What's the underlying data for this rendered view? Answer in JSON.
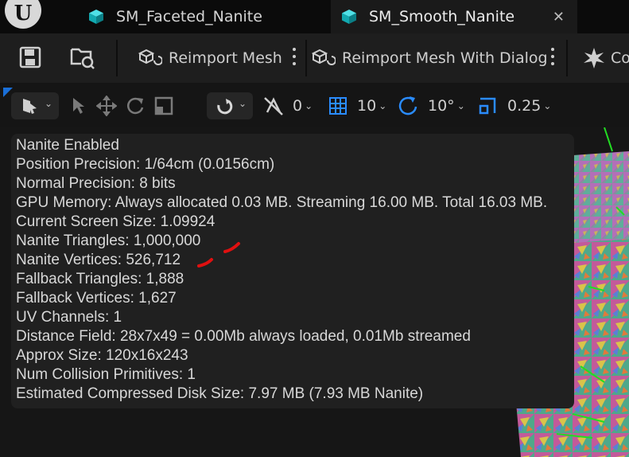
{
  "tabs": [
    {
      "label": "SM_Faceted_Nanite",
      "icon": "static-mesh-icon"
    },
    {
      "label": "SM_Smooth_Nanite",
      "icon": "static-mesh-icon",
      "active": true,
      "close": "✕"
    }
  ],
  "toolbar": {
    "reimport_mesh": "Reimport Mesh",
    "reimport_dialog": "Reimport Mesh With Dialog",
    "collision_partial": "Co"
  },
  "viewport_toolbar": {
    "rotation_snap_value": "0",
    "grid_snap_value": "10",
    "angle_snap_value": "10°",
    "scale_snap_value": "0.25"
  },
  "info_lines": [
    "Nanite Enabled",
    "Position Precision: 1/64cm (0.0156cm)",
    "Normal Precision: 8 bits",
    "GPU Memory: Always allocated 0.03 MB. Streaming 16.00 MB. Total 16.03 MB.",
    "Current Screen Size:  1.09924",
    "Nanite Triangles:  1,000,000",
    "Nanite Vertices:  526,712",
    "Fallback Triangles:  1,888",
    "Fallback Vertices:  1,627",
    "UV Channels:  1",
    "Distance Field:  28x7x49 = 0.00Mb always loaded, 0.01Mb streamed",
    "Approx Size: 120x16x243",
    "Num Collision Primitives:  1",
    "Estimated Compressed Disk Size: 7.97 MB (7.93 MB Nanite)"
  ],
  "colors": {
    "accent_teal": "#16c0c8",
    "accent_blue": "#2a8cff",
    "annotation_red": "#e01010"
  }
}
